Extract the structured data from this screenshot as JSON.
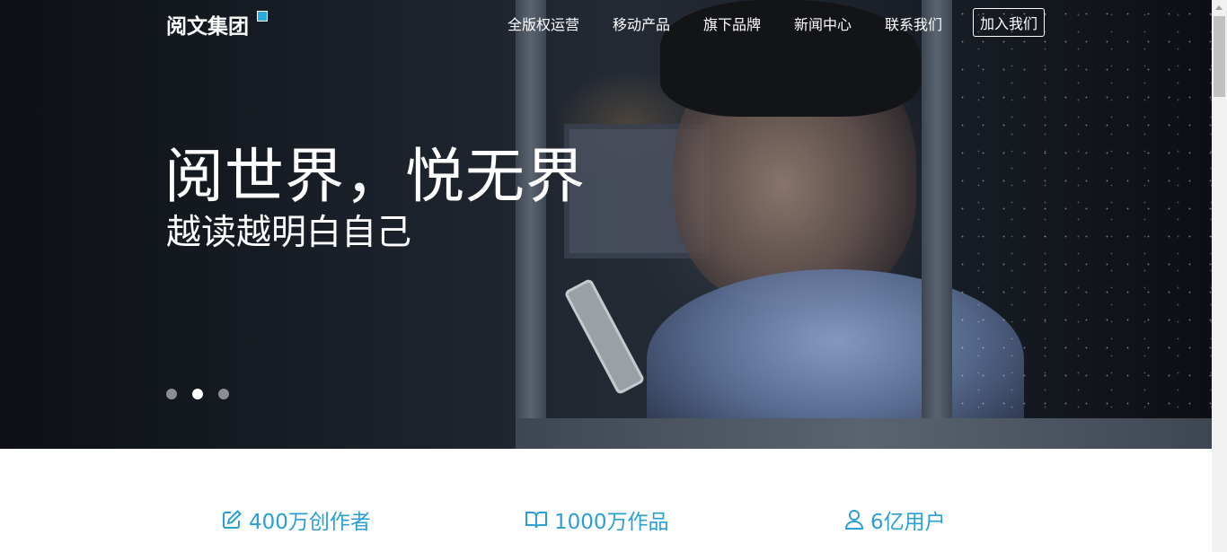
{
  "brand": {
    "name": "阅文集团",
    "accent_color": "#2aa8e0"
  },
  "nav": {
    "items": [
      {
        "label": "全版权运营"
      },
      {
        "label": "移动产品"
      },
      {
        "label": "旗下品牌"
      },
      {
        "label": "新闻中心"
      },
      {
        "label": "联系我们"
      }
    ],
    "join_label": "加入我们"
  },
  "hero": {
    "title": "阅世界，悦无界",
    "subtitle": "越读越明白自己",
    "slides_count": 3,
    "active_slide": 2
  },
  "stats": {
    "color": "#2a9fd6",
    "items": [
      {
        "icon": "edit-icon",
        "label": "400万创作者"
      },
      {
        "icon": "book-icon",
        "label": "1000万作品"
      },
      {
        "icon": "user-icon",
        "label": "6亿用户"
      }
    ]
  }
}
